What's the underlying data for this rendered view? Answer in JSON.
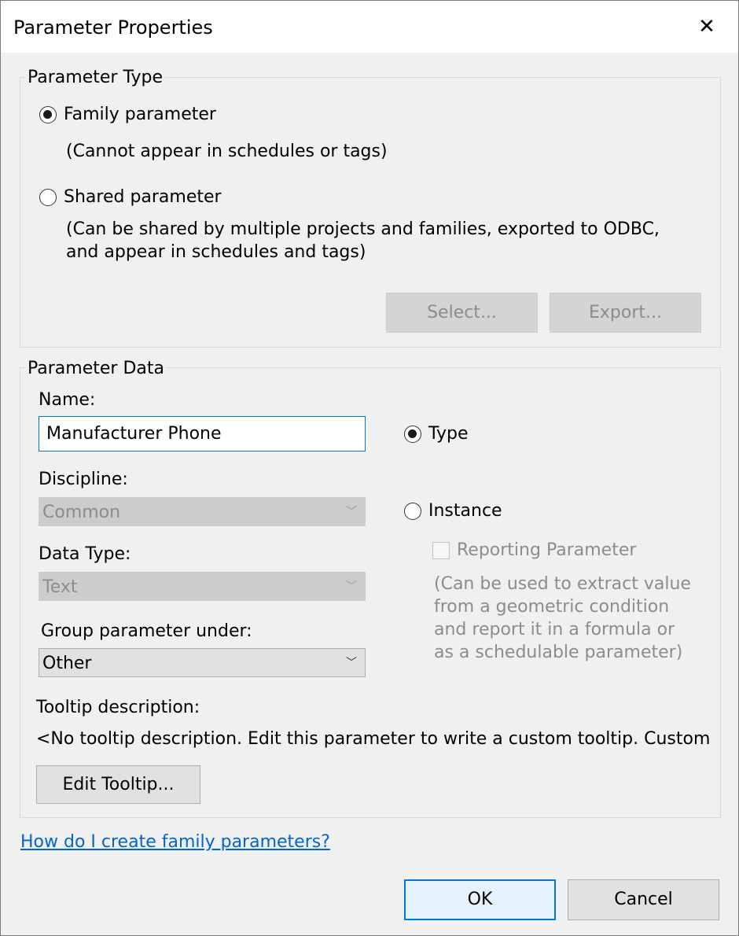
{
  "window": {
    "title": "Parameter Properties",
    "close_glyph": "✕"
  },
  "parameter_type": {
    "legend": "Parameter Type",
    "family": {
      "label": "Family parameter",
      "note": "(Cannot appear in schedules or tags)",
      "selected": true
    },
    "shared": {
      "label": "Shared parameter",
      "note": "(Can be shared by multiple projects and families, exported to ODBC, and appear in schedules and tags)",
      "selected": false
    },
    "select_label": "Select...",
    "export_label": "Export..."
  },
  "parameter_data": {
    "legend": "Parameter Data",
    "name_label": "Name:",
    "name_value": "Manufacturer Phone",
    "discipline_label": "Discipline:",
    "discipline_value": "Common",
    "data_type_label": "Data Type:",
    "data_type_value": "Text",
    "group_label": "Group parameter under:",
    "group_value": "Other",
    "type_label": "Type",
    "instance_label": "Instance",
    "reporting_label": "Reporting Parameter",
    "reporting_note": "(Can be used to extract value from a geometric condition and report it in a formula or as a schedulable parameter)",
    "tooltip_label": "Tooltip description:",
    "tooltip_text": "<No tooltip description. Edit this parameter to write a custom tooltip. Custom",
    "edit_tooltip_label": "Edit Tooltip..."
  },
  "help_link": "How do I create family parameters?",
  "footer": {
    "ok_label": "OK",
    "cancel_label": "Cancel"
  },
  "icons": {
    "chevron": "chevron-down-icon",
    "close": "close-icon"
  },
  "colors": {
    "accent": "#0078d7",
    "link": "#0066cc",
    "disabled_text": "#8c8c8c"
  }
}
